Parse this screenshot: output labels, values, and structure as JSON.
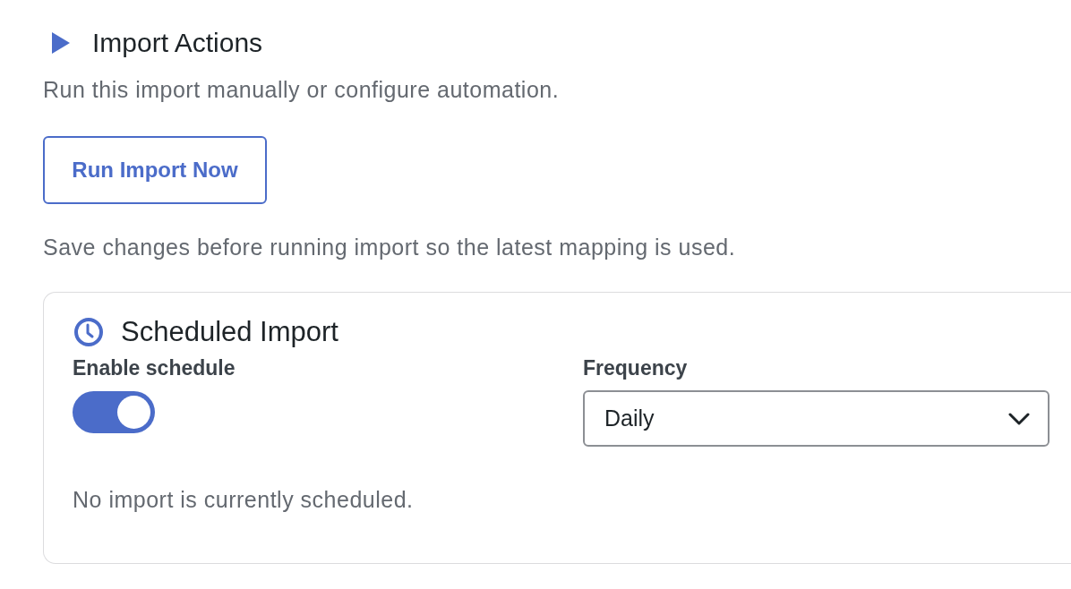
{
  "section": {
    "title": "Import Actions",
    "description": "Run this import manually or configure automation."
  },
  "run_button": {
    "label": "Run Import Now"
  },
  "hint": "Save changes before running import so the latest mapping is used.",
  "scheduled_import": {
    "title": "Scheduled Import",
    "enable_schedule": {
      "label": "Enable schedule",
      "on": true
    },
    "frequency": {
      "label": "Frequency",
      "value": "Daily"
    },
    "status": "No import is currently scheduled."
  }
}
